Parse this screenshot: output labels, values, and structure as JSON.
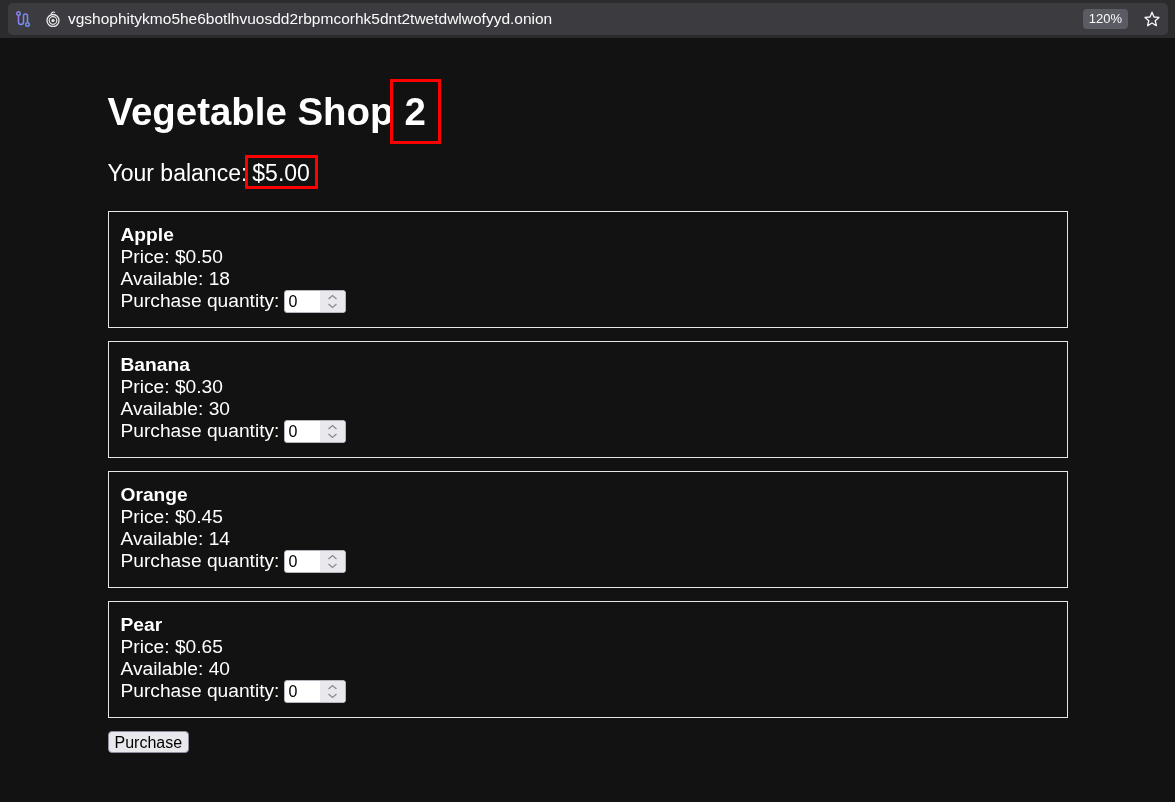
{
  "browser": {
    "url": "vgshophitykmo5he6botlhvuosdd2rbpmcorhk5dnt2twetdwlwofyyd.onion",
    "zoom": "120%"
  },
  "heading": {
    "text": "Vegetable Shop",
    "number": {
      "text": "2",
      "highlighted": true
    }
  },
  "balance": {
    "label": "Your balance:",
    "amount": {
      "text": "$5.00",
      "highlighted": true
    }
  },
  "products": [
    {
      "name": "Apple",
      "price": "Price: $0.50",
      "available": "Available: 18",
      "quantity_label": "Purchase quantity:",
      "quantity": "0"
    },
    {
      "name": "Banana",
      "price": "Price: $0.30",
      "available": "Available: 30",
      "quantity_label": "Purchase quantity:",
      "quantity": "0"
    },
    {
      "name": "Orange",
      "price": "Price: $0.45",
      "available": "Available: 14",
      "quantity_label": "Purchase quantity:",
      "quantity": "0"
    },
    {
      "name": "Pear",
      "price": "Price: $0.65",
      "available": "Available: 40",
      "quantity_label": "Purchase quantity:",
      "quantity": "0"
    }
  ],
  "purchase_button": "Purchase"
}
